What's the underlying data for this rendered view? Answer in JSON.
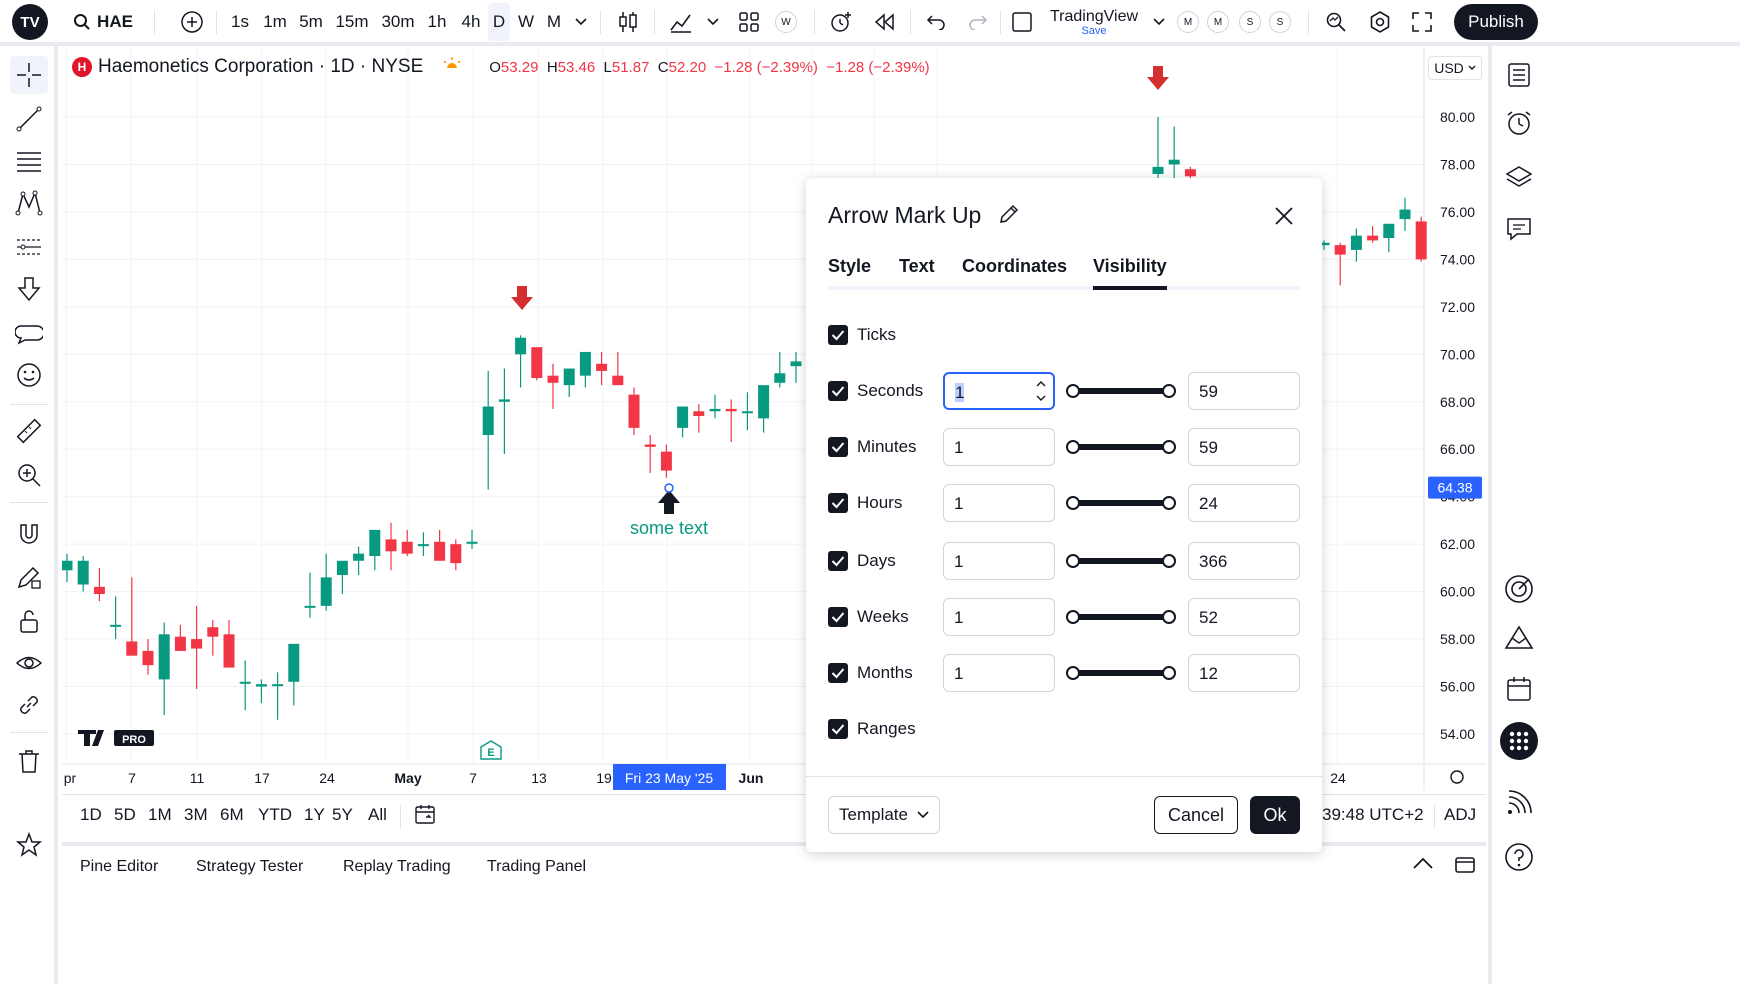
{
  "topbar": {
    "symbol": "HAE",
    "timeframes": [
      "1s",
      "1m",
      "5m",
      "15m",
      "30m",
      "1h",
      "4h",
      "D",
      "W",
      "M"
    ],
    "active_timeframe": "D",
    "layout_name": "TradingView",
    "save_label": "Save",
    "w_badge": "W",
    "circle_badges": [
      "M",
      "M",
      "S",
      "S"
    ],
    "publish_label": "Publish",
    "logo_text": "TV"
  },
  "legend": {
    "badge": "H",
    "title": "Haemonetics Corporation · 1D · NYSE",
    "o_label": "O",
    "o_value": "53.29",
    "h_label": "H",
    "h_value": "53.46",
    "l_label": "L",
    "l_value": "51.87",
    "c_label": "C",
    "c_value": "52.20",
    "change": "−1.28 (−2.39%)",
    "change2": "−1.28 (−2.39%)"
  },
  "currency": "USD",
  "price_axis": [
    "80.00",
    "78.00",
    "76.00",
    "74.00",
    "72.00",
    "70.00",
    "68.00",
    "66.00",
    "64.00",
    "62.00",
    "60.00",
    "58.00",
    "56.00",
    "54.00"
  ],
  "current_price": "64.38",
  "time_axis": [
    "pr",
    "7",
    "11",
    "17",
    "24",
    "May",
    "7",
    "13",
    "19",
    "Jun",
    "24"
  ],
  "crosshair_date": "Fri 23 May '25",
  "annotation_text": "some text",
  "earnings_badge": "E",
  "watermark": "PRO",
  "bottom": {
    "ranges": [
      "1D",
      "5D",
      "1M",
      "3M",
      "6M",
      "YTD",
      "1Y",
      "5Y",
      "All"
    ],
    "clock": "39:48 UTC+2",
    "adj": "ADJ"
  },
  "panels": [
    "Pine Editor",
    "Strategy Tester",
    "Replay Trading",
    "Trading Panel"
  ],
  "dialog": {
    "title": "Arrow Mark Up",
    "tabs": [
      "Style",
      "Text",
      "Coordinates",
      "Visibility"
    ],
    "active_tab": "Visibility",
    "rows": [
      {
        "label": "Ticks",
        "checked": true
      },
      {
        "label": "Seconds",
        "checked": true,
        "from": "1",
        "to": "59"
      },
      {
        "label": "Minutes",
        "checked": true,
        "from": "1",
        "to": "59"
      },
      {
        "label": "Hours",
        "checked": true,
        "from": "1",
        "to": "24"
      },
      {
        "label": "Days",
        "checked": true,
        "from": "1",
        "to": "366"
      },
      {
        "label": "Weeks",
        "checked": true,
        "from": "1",
        "to": "52"
      },
      {
        "label": "Months",
        "checked": true,
        "from": "1",
        "to": "12"
      },
      {
        "label": "Ranges",
        "checked": true
      }
    ],
    "template_label": "Template",
    "cancel_label": "Cancel",
    "ok_label": "Ok"
  },
  "colors": {
    "up": "#089981",
    "down": "#f23645",
    "accent": "#2962ff",
    "arrow_up": "#131722",
    "arrow_down": "#d32f2f"
  },
  "chart_data": {
    "type": "candlestick",
    "candles": [
      {
        "o": 60.9,
        "h": 61.6,
        "l": 60.4,
        "c": 61.3
      },
      {
        "o": 60.3,
        "h": 61.5,
        "l": 60.0,
        "c": 61.3
      },
      {
        "o": 60.2,
        "h": 61.0,
        "l": 59.6,
        "c": 59.9
      },
      {
        "o": 58.6,
        "h": 59.8,
        "l": 58.0,
        "c": 58.6
      },
      {
        "o": 57.9,
        "h": 60.6,
        "l": 57.8,
        "c": 57.3
      },
      {
        "o": 57.5,
        "h": 58.0,
        "l": 56.5,
        "c": 56.9
      },
      {
        "o": 56.3,
        "h": 58.7,
        "l": 54.8,
        "c": 58.2
      },
      {
        "o": 58.1,
        "h": 58.6,
        "l": 57.6,
        "c": 57.5
      },
      {
        "o": 58.0,
        "h": 59.4,
        "l": 55.9,
        "c": 57.6
      },
      {
        "o": 58.5,
        "h": 58.8,
        "l": 57.3,
        "c": 58.1
      },
      {
        "o": 58.2,
        "h": 58.8,
        "l": 56.8,
        "c": 56.8
      },
      {
        "o": 56.2,
        "h": 57.1,
        "l": 55.0,
        "c": 56.2
      },
      {
        "o": 56.0,
        "h": 56.3,
        "l": 55.3,
        "c": 56.1
      },
      {
        "o": 56.1,
        "h": 56.6,
        "l": 54.6,
        "c": 56.1
      },
      {
        "o": 56.2,
        "h": 56.8,
        "l": 55.2,
        "c": 57.8
      },
      {
        "o": 59.4,
        "h": 60.8,
        "l": 58.9,
        "c": 59.4
      },
      {
        "o": 59.4,
        "h": 61.6,
        "l": 59.2,
        "c": 60.6
      },
      {
        "o": 60.7,
        "h": 61.0,
        "l": 59.9,
        "c": 61.3
      },
      {
        "o": 61.3,
        "h": 61.9,
        "l": 60.7,
        "c": 61.6
      },
      {
        "o": 61.5,
        "h": 62.3,
        "l": 60.9,
        "c": 62.6
      },
      {
        "o": 62.2,
        "h": 62.9,
        "l": 60.9,
        "c": 61.7
      },
      {
        "o": 62.1,
        "h": 62.6,
        "l": 61.5,
        "c": 61.6
      },
      {
        "o": 62.0,
        "h": 62.5,
        "l": 61.5,
        "c": 62.0
      },
      {
        "o": 62.1,
        "h": 62.6,
        "l": 61.5,
        "c": 61.3
      },
      {
        "o": 62.0,
        "h": 62.2,
        "l": 60.9,
        "c": 61.2
      },
      {
        "o": 62.1,
        "h": 62.6,
        "l": 61.8,
        "c": 62.1
      },
      {
        "o": 66.6,
        "h": 69.3,
        "l": 64.3,
        "c": 67.8
      },
      {
        "o": 68.0,
        "h": 69.4,
        "l": 65.8,
        "c": 68.1
      },
      {
        "o": 70.0,
        "h": 70.8,
        "l": 68.6,
        "c": 70.7
      },
      {
        "o": 70.3,
        "h": 70.3,
        "l": 68.9,
        "c": 69.0
      },
      {
        "o": 69.1,
        "h": 69.6,
        "l": 67.7,
        "c": 68.8
      },
      {
        "o": 68.7,
        "h": 69.0,
        "l": 68.2,
        "c": 69.4
      },
      {
        "o": 69.1,
        "h": 69.9,
        "l": 68.6,
        "c": 70.1
      },
      {
        "o": 69.6,
        "h": 70.1,
        "l": 68.7,
        "c": 69.3
      },
      {
        "o": 69.1,
        "h": 70.1,
        "l": 68.7,
        "c": 68.7
      },
      {
        "o": 68.3,
        "h": 68.6,
        "l": 66.6,
        "c": 66.9
      },
      {
        "o": 66.2,
        "h": 66.6,
        "l": 65.0,
        "c": 66.1
      },
      {
        "o": 65.9,
        "h": 66.2,
        "l": 64.8,
        "c": 65.1
      },
      {
        "o": 66.9,
        "h": 67.5,
        "l": 66.5,
        "c": 67.8
      },
      {
        "o": 67.6,
        "h": 67.9,
        "l": 66.7,
        "c": 67.4
      },
      {
        "o": 67.6,
        "h": 68.3,
        "l": 67.3,
        "c": 67.7
      },
      {
        "o": 67.7,
        "h": 68.1,
        "l": 66.3,
        "c": 67.6
      },
      {
        "o": 67.6,
        "h": 68.4,
        "l": 66.8,
        "c": 67.6
      },
      {
        "o": 67.3,
        "h": 68.2,
        "l": 66.7,
        "c": 68.7
      },
      {
        "o": 68.8,
        "h": 70.1,
        "l": 68.6,
        "c": 69.2
      },
      {
        "o": 69.5,
        "h": 70.1,
        "l": 68.8,
        "c": 69.7
      },
      {
        "o": 69.6,
        "h": 70.5,
        "l": 69.1,
        "c": 70.2
      }
    ],
    "hidden_candles_right": [
      {
        "o": 77.6,
        "h": 80.0,
        "l": 77.1,
        "c": 77.9
      },
      {
        "o": 78.0,
        "h": 79.6,
        "l": 77.4,
        "c": 78.2
      },
      {
        "o": 77.8,
        "h": 77.9,
        "l": 77.4,
        "c": 77.5
      },
      {
        "o": 74.6,
        "h": 74.8,
        "l": 74.4,
        "c": 74.7
      },
      {
        "o": 74.6,
        "h": 74.7,
        "l": 72.9,
        "c": 74.2
      },
      {
        "o": 74.4,
        "h": 75.3,
        "l": 73.9,
        "c": 75.0
      },
      {
        "o": 75.0,
        "h": 75.4,
        "l": 74.7,
        "c": 74.8
      },
      {
        "o": 74.9,
        "h": 75.5,
        "l": 74.3,
        "c": 75.5
      },
      {
        "o": 75.7,
        "h": 76.6,
        "l": 75.2,
        "c": 76.1
      },
      {
        "o": 75.6,
        "h": 75.8,
        "l": 73.9,
        "c": 74.0
      }
    ],
    "ylim": [
      53,
      81
    ]
  }
}
